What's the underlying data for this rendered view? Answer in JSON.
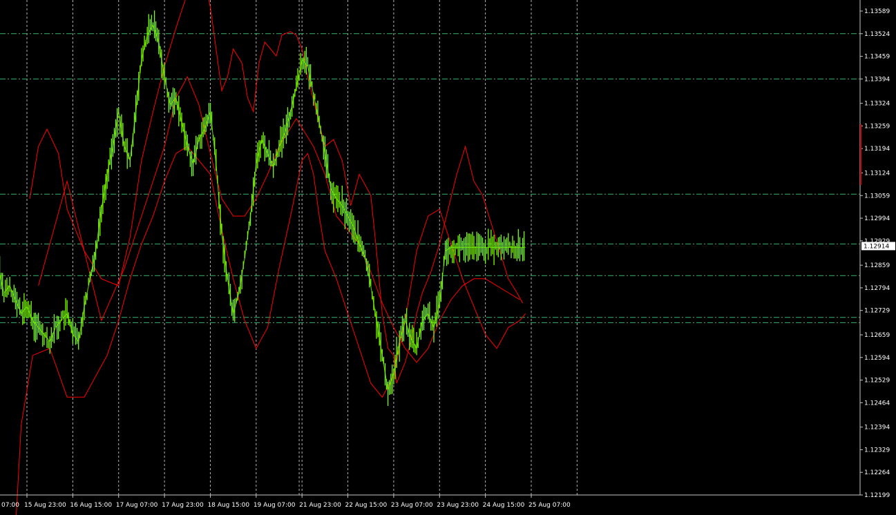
{
  "chart_data": {
    "type": "line",
    "title": "",
    "xlabel": "",
    "ylabel": "",
    "ylim": [
      1.12199,
      1.13589
    ],
    "x_ticks": [
      {
        "label": "07:00",
        "x": 0
      },
      {
        "label": "15 Aug 23:00",
        "x": 16
      },
      {
        "label": "16 Aug 15:00",
        "x": 32
      },
      {
        "label": "17 Aug 07:00",
        "x": 48
      },
      {
        "label": "17 Aug 23:00",
        "x": 64
      },
      {
        "label": "18 Aug 15:00",
        "x": 80
      },
      {
        "label": "19 Aug 07:00",
        "x": 96
      },
      {
        "label": "21 Aug 23:00",
        "x": 112
      },
      {
        "label": "22 Aug 15:00",
        "x": 128
      },
      {
        "label": "23 Aug 07:00",
        "x": 144
      },
      {
        "label": "23 Aug 23:00",
        "x": 160
      },
      {
        "label": "24 Aug 15:00",
        "x": 176
      },
      {
        "label": "25 Aug 07:00",
        "x": 192
      }
    ],
    "y_ticks": [
      "1.13589",
      "1.13524",
      "1.13459",
      "1.13394",
      "1.13324",
      "1.13259",
      "1.13194",
      "1.13124",
      "1.13059",
      "1.12994",
      "1.12929",
      "1.12859",
      "1.12794",
      "1.12729",
      "1.12659",
      "1.12594",
      "1.12529",
      "1.12464",
      "1.12394",
      "1.12329",
      "1.12264",
      "1.12199"
    ],
    "current_price": "1.12914",
    "horizontal_levels": [
      1.13524,
      1.13394,
      1.13063,
      1.1292,
      1.12829,
      1.12709,
      1.12694
    ],
    "vertical_gridlines_x": [
      0,
      16,
      32,
      48,
      64,
      80,
      96,
      111,
      112,
      128,
      144,
      160,
      176,
      192,
      208
    ],
    "price_series": {
      "name": "",
      "x": [
        0,
        2,
        4,
        6,
        8,
        10,
        12,
        14,
        16,
        18,
        20,
        22,
        24,
        26,
        28,
        30,
        32,
        34,
        36,
        38,
        40,
        42,
        44,
        46,
        48,
        50,
        52,
        54,
        56,
        58,
        60,
        62,
        64,
        66,
        68,
        70,
        72,
        74,
        76,
        78,
        80,
        82,
        84,
        86,
        88,
        90,
        92,
        94,
        96,
        98,
        100,
        102,
        104,
        106,
        108,
        110,
        112,
        114,
        116,
        118,
        120,
        122,
        124,
        126,
        128,
        130,
        132,
        134,
        136,
        138,
        140,
        142,
        144,
        146,
        148,
        150,
        152,
        154,
        156,
        158,
        160,
        162,
        164,
        166,
        168,
        170,
        172,
        174,
        176,
        178,
        180,
        182,
        184,
        186,
        188,
        190,
        192,
        194
      ],
      "y": [
        1.122,
        1.1255,
        1.127,
        1.1285,
        1.1278,
        1.128,
        1.1276,
        1.1272,
        1.1274,
        1.127,
        1.1268,
        1.1266,
        1.1264,
        1.1268,
        1.127,
        1.1272,
        1.1266,
        1.1264,
        1.1274,
        1.1282,
        1.129,
        1.1302,
        1.1312,
        1.132,
        1.133,
        1.132,
        1.1316,
        1.133,
        1.1345,
        1.1352,
        1.1355,
        1.135,
        1.134,
        1.1332,
        1.1334,
        1.1327,
        1.132,
        1.1315,
        1.1322,
        1.1325,
        1.133,
        1.1315,
        1.1295,
        1.1282,
        1.1272,
        1.1278,
        1.1288,
        1.13,
        1.1315,
        1.1322,
        1.1318,
        1.1314,
        1.132,
        1.1324,
        1.133,
        1.1337,
        1.1345,
        1.1343,
        1.1335,
        1.1327,
        1.1318,
        1.1308,
        1.1305,
        1.1303,
        1.13,
        1.1297,
        1.1292,
        1.1288,
        1.128,
        1.127,
        1.126,
        1.125,
        1.1255,
        1.1264,
        1.127,
        1.1265,
        1.1262,
        1.127,
        1.1272,
        1.1268,
        1.1275,
        1.129,
        1.1291,
        1.1291,
        1.1291,
        1.1291,
        1.1291,
        1.1291,
        1.1291,
        1.1291,
        1.1291,
        1.1291,
        1.1291,
        1.1291,
        1.1291,
        1.1291,
        1.1291,
        1.1291
      ]
    },
    "band_upper": {
      "x": [
        17,
        20,
        23,
        27,
        30,
        36,
        42,
        48,
        52,
        56,
        60,
        64,
        68,
        72,
        77,
        80,
        82,
        84,
        86,
        88,
        91,
        93,
        95,
        97,
        99,
        101,
        103,
        105,
        108,
        110,
        112,
        114,
        117,
        120,
        123,
        126,
        129,
        132,
        136,
        138,
        140,
        142,
        144,
        145,
        146,
        148,
        150,
        152,
        154,
        157,
        160,
        163,
        166,
        169,
        172,
        175,
        178,
        181,
        184,
        187,
        189
      ],
      "y": [
        1.1305,
        1.132,
        1.1325,
        1.1318,
        1.1302,
        1.129,
        1.1282,
        1.128,
        1.1294,
        1.1316,
        1.133,
        1.1343,
        1.1354,
        1.1364,
        1.1372,
        1.136,
        1.1348,
        1.1336,
        1.134,
        1.1348,
        1.1344,
        1.1334,
        1.133,
        1.1344,
        1.135,
        1.1348,
        1.1346,
        1.1352,
        1.1353,
        1.1352,
        1.1348,
        1.134,
        1.133,
        1.132,
        1.1322,
        1.1316,
        1.1303,
        1.1312,
        1.1306,
        1.129,
        1.1272,
        1.1262,
        1.126,
        1.1252,
        1.1254,
        1.1258,
        1.1264,
        1.1272,
        1.1278,
        1.1284,
        1.1292,
        1.1302,
        1.1312,
        1.132,
        1.131,
        1.1306,
        1.1298,
        1.129,
        1.1282,
        1.1278,
        1.1275
      ]
    },
    "band_middle": {
      "x": [
        20,
        30,
        42,
        50,
        56,
        60,
        64,
        68,
        72,
        76,
        78,
        80,
        84,
        88,
        92,
        96,
        100,
        104,
        110,
        116,
        120,
        124,
        128,
        132,
        136,
        140,
        144,
        148,
        152,
        156,
        160,
        164,
        168,
        172,
        176,
        180,
        184,
        188
      ],
      "y": [
        1.128,
        1.131,
        1.127,
        1.1285,
        1.13,
        1.131,
        1.132,
        1.1334,
        1.134,
        1.1332,
        1.1325,
        1.1318,
        1.1305,
        1.13,
        1.13,
        1.1305,
        1.1312,
        1.132,
        1.1328,
        1.132,
        1.1312,
        1.13,
        1.1296,
        1.1292,
        1.1284,
        1.1275,
        1.1268,
        1.1262,
        1.1258,
        1.1262,
        1.127,
        1.1276,
        1.128,
        1.1282,
        1.1282,
        1.128,
        1.1278,
        1.1276
      ]
    },
    "band_lower": {
      "x": [
        12,
        14,
        18,
        24,
        30,
        36,
        40,
        44,
        48,
        52,
        56,
        60,
        64,
        68,
        72,
        76,
        80,
        84,
        88,
        92,
        96,
        100,
        104,
        108,
        112,
        114,
        116,
        118,
        120,
        124,
        128,
        132,
        136,
        140,
        144,
        148,
        152,
        156,
        160,
        164,
        168,
        172,
        176,
        180,
        184,
        188,
        190
      ],
      "y": [
        1.121,
        1.124,
        1.126,
        1.1262,
        1.1248,
        1.1248,
        1.1254,
        1.126,
        1.127,
        1.1282,
        1.1292,
        1.13,
        1.131,
        1.1318,
        1.132,
        1.1316,
        1.1312,
        1.1296,
        1.1282,
        1.127,
        1.1262,
        1.1268,
        1.1285,
        1.13,
        1.1316,
        1.1318,
        1.1312,
        1.13,
        1.129,
        1.1282,
        1.1272,
        1.1262,
        1.1252,
        1.1248,
        1.1254,
        1.127,
        1.129,
        1.13,
        1.1302,
        1.1292,
        1.1282,
        1.1274,
        1.1266,
        1.1262,
        1.1268,
        1.127,
        1.1272
      ]
    }
  },
  "colors": {
    "background": "#000000",
    "price": "#7CFC00",
    "band": "#FF0000",
    "level_line": "#3CB371",
    "grid": "#C8C8C8",
    "axis_text": "#FFFFFF",
    "price_tag_bg": "#FFFFFF",
    "price_tag_text": "#000000"
  }
}
